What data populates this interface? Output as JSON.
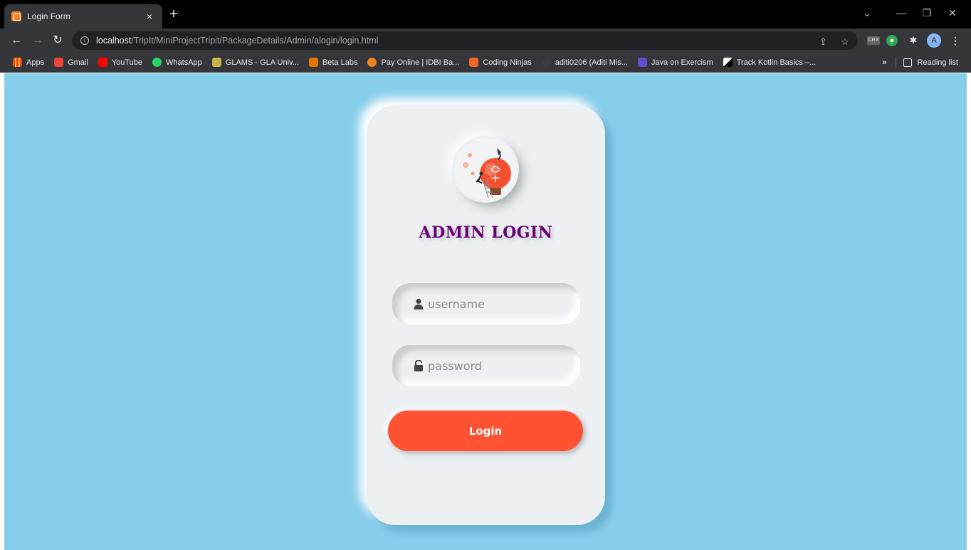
{
  "browser": {
    "tab_title": "Login Form",
    "tab_close": "×",
    "new_tab": "+",
    "url_host": "localhost",
    "url_path": "/TripIt/MiniProjectTripit/PackageDetails/Admin/alogin/login.html",
    "profile_initial": "A",
    "crx_label": "CRX",
    "bookmarks": [
      {
        "label": "Apps",
        "color": "#ea4335"
      },
      {
        "label": "Gmail",
        "color": "#ea4335"
      },
      {
        "label": "YouTube",
        "color": "#ff0000"
      },
      {
        "label": "WhatsApp",
        "color": "#25d366"
      },
      {
        "label": "GLAMS - GLA Univ...",
        "color": "#c9b24d"
      },
      {
        "label": "Beta Labs",
        "color": "#e37400"
      },
      {
        "label": "Pay Online | IDBI Ba...",
        "color": "#f58220"
      },
      {
        "label": "Coding Ninjas",
        "color": "#f26522"
      },
      {
        "label": "aditi0206 (Aditi Mis...",
        "color": "#24292e"
      },
      {
        "label": "Java on Exercism",
        "color": "#604fcd"
      },
      {
        "label": "Track Kotlin Basics –...",
        "color": "#ffffff"
      }
    ],
    "bookmarks_more": "»",
    "reading_list": "Reading list"
  },
  "page": {
    "background": "#87ceeb",
    "title": "ADMIN LOGIN",
    "username_placeholder": "username",
    "password_placeholder": "password",
    "login_label": "Login",
    "accent": "#ff5233",
    "title_color": "#6a0073"
  }
}
